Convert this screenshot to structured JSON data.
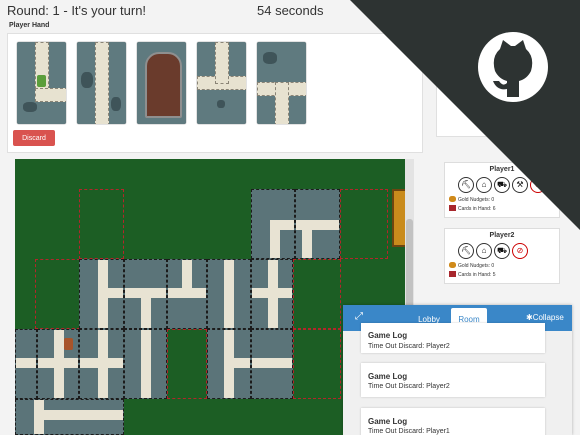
{
  "header": {
    "round_text": "Round: 1 - It's your turn!",
    "timer_text": "54 seconds"
  },
  "hand": {
    "label": "Player Hand",
    "discard_label": "Discard",
    "cards": [
      {
        "name": "path-card-1"
      },
      {
        "name": "path-card-2"
      },
      {
        "name": "door-card"
      },
      {
        "name": "path-card-4"
      },
      {
        "name": "path-card-5"
      }
    ]
  },
  "players": [
    {
      "name": "Player1",
      "gold_label": "Gold Nudgets: 0",
      "cards_label": "Cards in Hand: 6",
      "tools": [
        {
          "icon": "pickaxe-icon",
          "glyph": "⛏",
          "broken": false
        },
        {
          "icon": "lantern-icon",
          "glyph": "⌂",
          "broken": false
        },
        {
          "icon": "cart-icon",
          "glyph": "⛟",
          "broken": false
        },
        {
          "icon": "hammer-icon",
          "glyph": "⚒",
          "broken": false
        },
        {
          "icon": "broken-tool-icon",
          "glyph": "⊘",
          "broken": true
        }
      ]
    },
    {
      "name": "Player2",
      "gold_label": "Gold Nudgets: 0",
      "cards_label": "Cards in Hand: 5",
      "tools": [
        {
          "icon": "pickaxe-icon",
          "glyph": "⛏",
          "broken": false
        },
        {
          "icon": "lantern-icon",
          "glyph": "⌂",
          "broken": false
        },
        {
          "icon": "cart-icon",
          "glyph": "⛟",
          "broken": false
        },
        {
          "icon": "broken-tool-icon",
          "glyph": "⊘",
          "broken": true
        }
      ]
    }
  ],
  "chat": {
    "expand_icon": "expand-icon",
    "tabs": [
      "Lobby",
      "Room"
    ],
    "active_tab": "Room",
    "collapse_label": "Collapse",
    "logs": [
      {
        "title": "Game Log",
        "text": "Time Out Discard: Player2"
      },
      {
        "title": "Game Log",
        "text": "Time Out Discard: Player2"
      },
      {
        "title": "Game Log",
        "text": "Time Out Discard: Player1"
      }
    ]
  },
  "colors": {
    "board_green": "#1c5e24",
    "discard_red": "#d9534f",
    "chat_blue": "#3a87c8",
    "corner_dark": "#2d3332"
  },
  "corner_icon": "github-icon"
}
